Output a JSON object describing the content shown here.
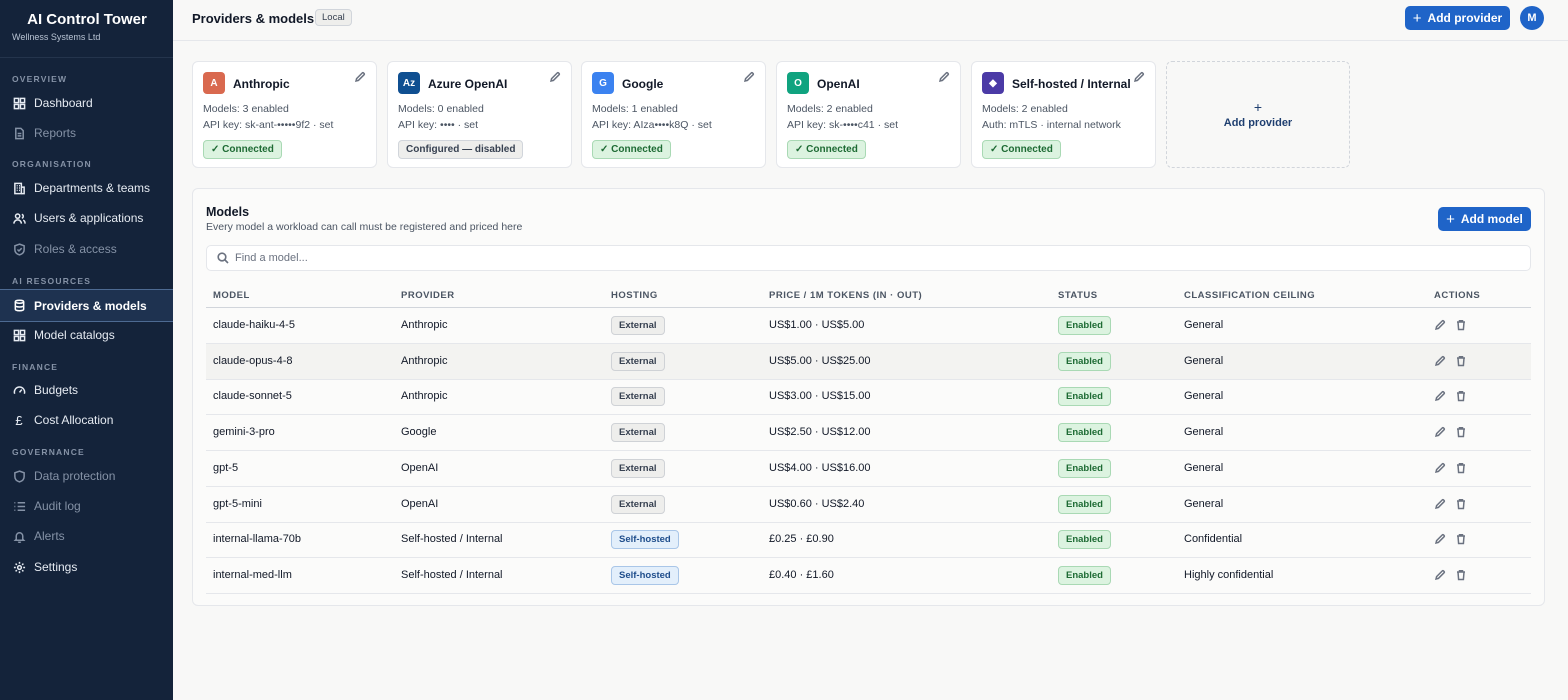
{
  "sidebar": {
    "brand_title": "AI Control Tower",
    "brand_sub": "Wellness Systems Ltd",
    "sections": {
      "overview": "OVERVIEW",
      "organisation": "ORGANISATION",
      "ai_resources": "AI RESOURCES",
      "finance": "FINANCE",
      "governance": "GOVERNANCE"
    },
    "items": {
      "dashboard": "Dashboard",
      "reports": "Reports",
      "departments": "Departments & teams",
      "users": "Users & applications",
      "roles": "Roles & access",
      "providers": "Providers & models",
      "catalogs": "Model catalogs",
      "budgets": "Budgets",
      "cost": "Cost Allocation",
      "data_protection": "Data protection",
      "audit": "Audit log",
      "alerts": "Alerts",
      "settings": "Settings"
    }
  },
  "header": {
    "title": "Providers & models",
    "badge": "Local",
    "add_provider": "Add provider",
    "avatar": "M"
  },
  "providers": [
    {
      "logo": "A",
      "color": "#d9694f",
      "name": "Anthropic",
      "line1": "Models: 3 enabled",
      "line2": "API key: sk-ant-•••••9f2 · set",
      "status": "✓ Connected"
    },
    {
      "logo": "Az",
      "color": "#0f4f91",
      "name": "Azure OpenAI",
      "line1": "Models: 0 enabled",
      "line2": "API key: •••• · set",
      "status": "Configured — disabled"
    },
    {
      "logo": "G",
      "color": "#3b82f0",
      "name": "Google",
      "line1": "Models: 1 enabled",
      "line2": "API key: AIza••••k8Q · set",
      "status": "✓ Connected"
    },
    {
      "logo": "O",
      "color": "#10a37f",
      "name": "OpenAI",
      "line1": "Models: 2 enabled",
      "line2": "API key: sk-••••c41 · set",
      "status": "✓ Connected"
    },
    {
      "logo": "◆",
      "color": "#4b3aa6",
      "name": "Self-hosted / Internal",
      "line1": "Models: 2 enabled",
      "line2": "Auth: mTLS · internal network",
      "status": "✓ Connected"
    }
  ],
  "add_card": {
    "plus": "+",
    "label": "Add provider"
  },
  "models": {
    "title": "Models",
    "subtitle": "Every model a workload can call must be registered and priced here",
    "add_model": "Add model",
    "search_placeholder": "Find a model...",
    "columns": {
      "model": "MODEL",
      "provider": "PROVIDER",
      "hosting": "HOSTING",
      "price": "PRICE / 1M TOKENS (IN · OUT)",
      "status": "STATUS",
      "ceiling": "CLASSIFICATION CEILING",
      "actions": "ACTIONS"
    },
    "rows": [
      {
        "model": "claude-haiku-4-5",
        "provider": "Anthropic",
        "hosting": "External",
        "price": "US$1.00 · US$5.00",
        "status": "Enabled",
        "ceiling": "General"
      },
      {
        "model": "claude-opus-4-8",
        "provider": "Anthropic",
        "hosting": "External",
        "price": "US$5.00 · US$25.00",
        "status": "Enabled",
        "ceiling": "General"
      },
      {
        "model": "claude-sonnet-5",
        "provider": "Anthropic",
        "hosting": "External",
        "price": "US$3.00 · US$15.00",
        "status": "Enabled",
        "ceiling": "General"
      },
      {
        "model": "gemini-3-pro",
        "provider": "Google",
        "hosting": "External",
        "price": "US$2.50 · US$12.00",
        "status": "Enabled",
        "ceiling": "General"
      },
      {
        "model": "gpt-5",
        "provider": "OpenAI",
        "hosting": "External",
        "price": "US$4.00 · US$16.00",
        "status": "Enabled",
        "ceiling": "General"
      },
      {
        "model": "gpt-5-mini",
        "provider": "OpenAI",
        "hosting": "External",
        "price": "US$0.60 · US$2.40",
        "status": "Enabled",
        "ceiling": "General"
      },
      {
        "model": "internal-llama-70b",
        "provider": "Self-hosted / Internal",
        "hosting": "Self-hosted",
        "price": "£0.25 · £0.90",
        "status": "Enabled",
        "ceiling": "Confidential"
      },
      {
        "model": "internal-med-llm",
        "provider": "Self-hosted / Internal",
        "hosting": "Self-hosted",
        "price": "£0.40 · £1.60",
        "status": "Enabled",
        "ceiling": "Highly confidential"
      }
    ]
  }
}
